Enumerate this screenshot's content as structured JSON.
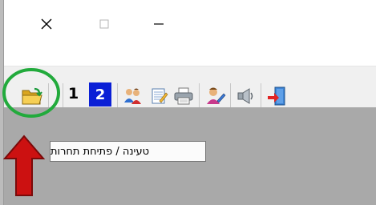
{
  "window": {
    "titlebar": {
      "close_glyph": "✕",
      "maximize_glyph": "☐",
      "minimize_glyph": "—"
    }
  },
  "toolbar": {
    "items": [
      {
        "name": "open-folder-icon",
        "kind": "icon"
      },
      {
        "name": "test-1-button",
        "label": "1"
      },
      {
        "name": "test-2-button",
        "label": "2"
      },
      {
        "name": "users-icon",
        "kind": "icon"
      },
      {
        "name": "edit-notebook-icon",
        "kind": "icon"
      },
      {
        "name": "printer-icon",
        "kind": "icon"
      },
      {
        "name": "user-edit-icon",
        "kind": "icon"
      },
      {
        "name": "speaker-icon",
        "kind": "icon"
      },
      {
        "name": "exit-door-icon",
        "kind": "icon"
      }
    ]
  },
  "tooltip": {
    "text": "טעינה / פתיחת תחרות"
  },
  "annotations": {
    "circle_color": "#22aa3c",
    "arrow_color": "#cc1111"
  }
}
